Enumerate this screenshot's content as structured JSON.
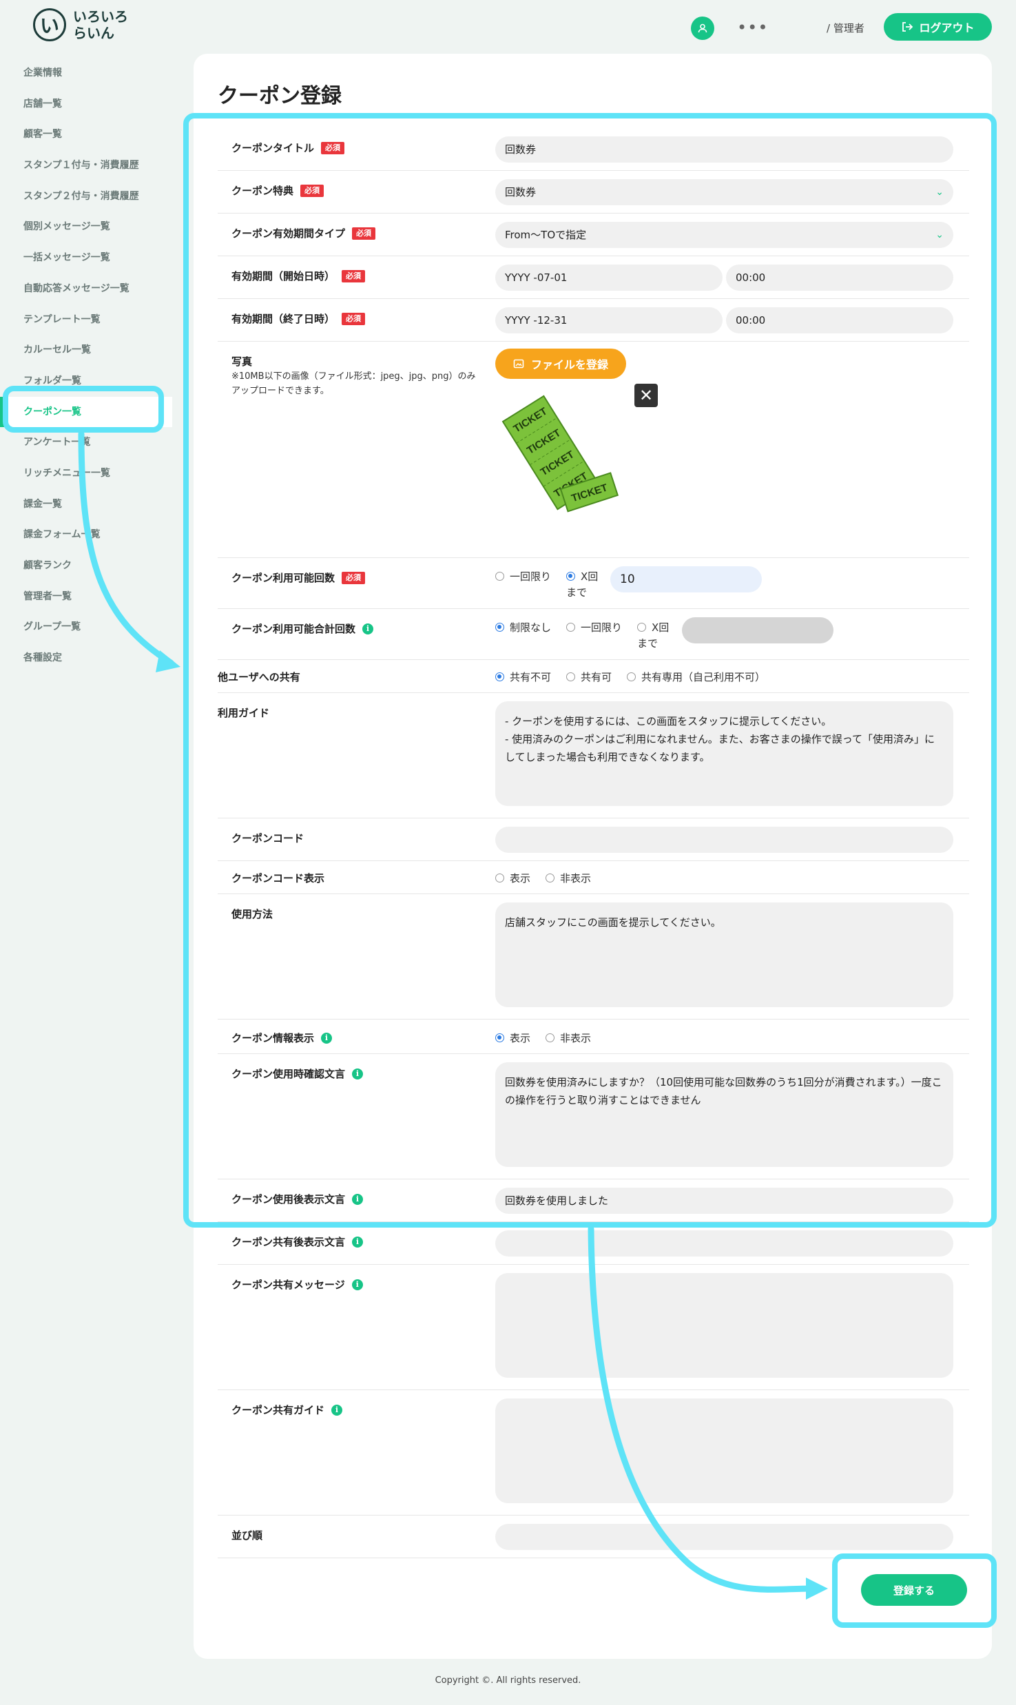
{
  "app": {
    "logo_mark": "い",
    "logo_text": "いろいろらいん"
  },
  "header": {
    "dots": "•••",
    "role": "/ 管理者",
    "logout": "ログアウト"
  },
  "sidebar": {
    "items": [
      {
        "label": "企業情報"
      },
      {
        "label": "店舗一覧"
      },
      {
        "label": "顧客一覧"
      },
      {
        "label": "スタンプ１付与・消費履歴"
      },
      {
        "label": "スタンプ２付与・消費履歴"
      },
      {
        "label": "個別メッセージ一覧"
      },
      {
        "label": "一括メッセージ一覧"
      },
      {
        "label": "自動応答メッセージ一覧"
      },
      {
        "label": "テンプレート一覧"
      },
      {
        "label": "カルーセル一覧"
      },
      {
        "label": "フォルダ一覧"
      },
      {
        "label": "クーポン一覧",
        "active": true
      },
      {
        "label": "アンケート一覧"
      },
      {
        "label": "リッチメニュー一覧"
      },
      {
        "label": "課金一覧"
      },
      {
        "label": "課金フォーム一覧"
      },
      {
        "label": "顧客ランク"
      },
      {
        "label": "管理者一覧"
      },
      {
        "label": "グループ一覧"
      },
      {
        "label": "各種設定"
      }
    ]
  },
  "page": {
    "title": "クーポン登録",
    "required_badge": "必須"
  },
  "form": {
    "coupon_title": {
      "label": "クーポンタイトル",
      "value": "回数券"
    },
    "benefit": {
      "label": "クーポン特典",
      "value": "回数券"
    },
    "period_type": {
      "label": "クーポン有効期間タイプ",
      "value": "From〜TOで指定"
    },
    "start": {
      "label": "有効期間（開始日時）",
      "date": "YYYY -07-01",
      "time": "00:00"
    },
    "end": {
      "label": "有効期間（終了日時）",
      "date": "YYYY -12-31",
      "time": "00:00"
    },
    "photo": {
      "label": "写真",
      "note": "※10MB以下の画像（ファイル形式：jpeg、jpg、png）のみアップロードできます。",
      "button": "ファイルを登録",
      "ticket_text": "TICKET"
    },
    "use_count": {
      "label": "クーポン利用可能回数",
      "opt1": "一回限り",
      "opt2": "X回",
      "opt2_suffix": "まで",
      "value": "10"
    },
    "total_count": {
      "label": "クーポン利用可能合計回数",
      "opt1": "制限なし",
      "opt2": "一回限り",
      "opt3": "X回",
      "opt3_suffix": "まで"
    },
    "share": {
      "label": "他ユーザへの共有",
      "opt1": "共有不可",
      "opt2": "共有可",
      "opt3": "共有専用（自己利用不可）"
    },
    "guide": {
      "label": "利用ガイド",
      "value": "- クーポンを使用するには、この画面をスタッフに提示してください。\n- 使用済みのクーポンはご利用になれません。また、お客さまの操作で誤って「使用済み」にしてしまった場合も利用できなくなります。"
    },
    "code": {
      "label": "クーポンコード",
      "value": ""
    },
    "code_display": {
      "label": "クーポンコード表示",
      "opt1": "表示",
      "opt2": "非表示"
    },
    "usage": {
      "label": "使用方法",
      "value": "店舗スタッフにこの画面を提示してください。"
    },
    "info_display": {
      "label": "クーポン情報表示",
      "opt1": "表示",
      "opt2": "非表示"
    },
    "confirm_text": {
      "label": "クーポン使用時確認文言",
      "value": "回数券を使用済みにしますか？（10回使用可能な回数券のうち1回分が消費されます。）一度この操作を行うと取り消すことはできません"
    },
    "after_use": {
      "label": "クーポン使用後表示文言",
      "value": "回数券を使用しました"
    },
    "after_share": {
      "label": "クーポン共有後表示文言",
      "value": ""
    },
    "share_message": {
      "label": "クーポン共有メッセージ",
      "value": ""
    },
    "share_guide": {
      "label": "クーポン共有ガイド",
      "value": ""
    },
    "sort": {
      "label": "並び順",
      "value": ""
    },
    "submit": "登録する"
  },
  "footer": {
    "copyright": "Copyright ©. All rights reserved."
  },
  "colors": {
    "accent": "#17c487",
    "highlight": "#5ee3f7",
    "required": "#e9363c",
    "file_button": "#f7a41c"
  }
}
